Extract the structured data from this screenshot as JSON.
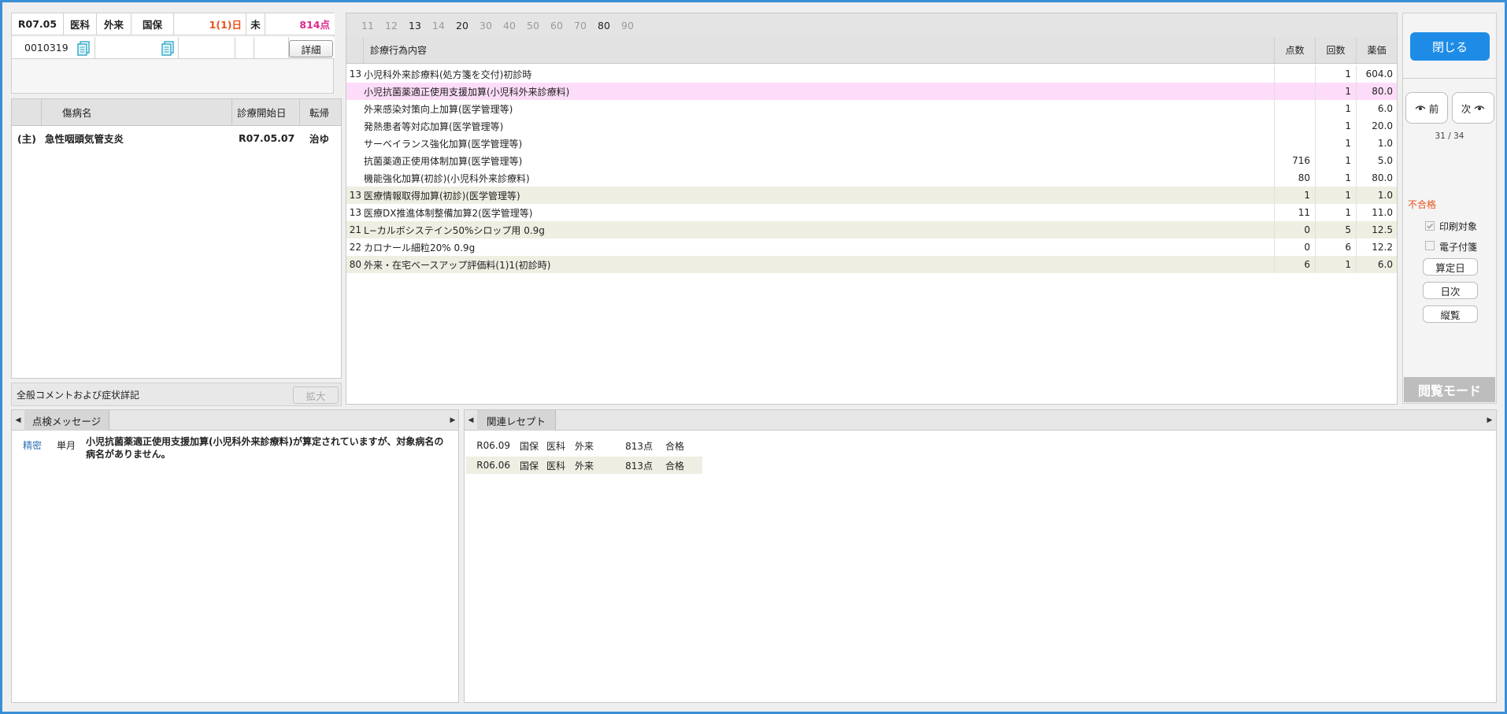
{
  "header": {
    "month": "R07.05",
    "dept": "医科",
    "visit_type": "外来",
    "insurance": "国保",
    "days": "1(1)日",
    "unsettled": "未",
    "points": "814点",
    "patient_id": "0010319",
    "detail_label": "詳細",
    "colors": {
      "days": "#e8521c",
      "points": "#e0288a"
    }
  },
  "diseases": {
    "headers": [
      "傷病名",
      "診療開始日",
      "転帰"
    ],
    "rows": [
      {
        "prefix": "(主)",
        "name": "急性咽頭気管支炎",
        "start": "R07.05.07",
        "outcome": "治ゆ"
      }
    ]
  },
  "comment": {
    "label": "全般コメントおよび症状詳記",
    "expand_label": "拡大"
  },
  "procedures": {
    "tab_numbers": [
      {
        "n": "11",
        "on": false
      },
      {
        "n": "12",
        "on": false
      },
      {
        "n": "13",
        "on": true
      },
      {
        "n": "14",
        "on": false
      },
      {
        "n": "20",
        "on": true
      },
      {
        "n": "30",
        "on": false
      },
      {
        "n": "40",
        "on": false
      },
      {
        "n": "50",
        "on": false
      },
      {
        "n": "60",
        "on": false
      },
      {
        "n": "70",
        "on": false
      },
      {
        "n": "80",
        "on": true
      },
      {
        "n": "90",
        "on": false
      }
    ],
    "headers": {
      "name": "診療行為内容",
      "points": "点数",
      "count": "回数",
      "price": "薬価"
    },
    "rows": [
      {
        "code": "13",
        "name": "小児科外来診療料(処方箋を交付)初診時",
        "points": "",
        "count": "1",
        "price": "604.0",
        "style": "plain"
      },
      {
        "code": "",
        "name": "小児抗菌薬適正使用支援加算(小児科外来診療料)",
        "points": "",
        "count": "1",
        "price": "80.0",
        "style": "pink"
      },
      {
        "code": "",
        "name": "外来感染対策向上加算(医学管理等)",
        "points": "",
        "count": "1",
        "price": "6.0",
        "style": "plain"
      },
      {
        "code": "",
        "name": "発熱患者等対応加算(医学管理等)",
        "points": "",
        "count": "1",
        "price": "20.0",
        "style": "plain"
      },
      {
        "code": "",
        "name": "サーベイランス強化加算(医学管理等)",
        "points": "",
        "count": "1",
        "price": "1.0",
        "style": "plain"
      },
      {
        "code": "",
        "name": "抗菌薬適正使用体制加算(医学管理等)",
        "points": "716",
        "count": "1",
        "price": "5.0",
        "style": "plain"
      },
      {
        "code": "",
        "name": "機能強化加算(初診)(小児科外来診療料)",
        "points": "80",
        "count": "1",
        "price": "80.0",
        "style": "plain"
      },
      {
        "code": "13",
        "name": "医療情報取得加算(初診)(医学管理等)",
        "points": "1",
        "count": "1",
        "price": "1.0",
        "style": "shade"
      },
      {
        "code": "13",
        "name": "医療DX推進体制整備加算2(医学管理等)",
        "points": "11",
        "count": "1",
        "price": "11.0",
        "style": "plain"
      },
      {
        "code": "21",
        "name": "L−カルボシステイン50%シロップ用 0.9g",
        "points": "0",
        "count": "5",
        "price": "12.5",
        "style": "shade"
      },
      {
        "code": "22",
        "name": "カロナール細粒20% 0.9g",
        "points": "0",
        "count": "6",
        "price": "12.2",
        "style": "plain"
      },
      {
        "code": "80",
        "name": "外来・在宅ベースアップ評価料(1)1(初診時)",
        "points": "6",
        "count": "1",
        "price": "6.0",
        "style": "shade"
      }
    ]
  },
  "side": {
    "close_label": "閉じる",
    "prev_label": "前",
    "next_label": "次",
    "pager": "31 / 34",
    "status": "不合格",
    "status_color": "#e8521c",
    "print_target": "印刷対象",
    "e_tag": "電子付箋",
    "calc_day_label": "算定日",
    "daily_label": "日次",
    "overview_label": "縦覧",
    "mode_label": "閲覧モード"
  },
  "check_messages": {
    "tab_label": "点検メッセージ",
    "rows": [
      {
        "kind": "精密",
        "period": "単月",
        "text_line1": "小児抗菌薬適正使用支援加算(小児科外来診療料)が算定されていますが、対象病名の",
        "text_line2": "病名がありません。"
      }
    ]
  },
  "related": {
    "tab_label": "関連レセプト",
    "rows": [
      {
        "month": "R06.09",
        "ins": "国保",
        "dept": "医科",
        "visit": "外来",
        "points": "813点",
        "result": "合格",
        "shade": false
      },
      {
        "month": "R06.06",
        "ins": "国保",
        "dept": "医科",
        "visit": "外来",
        "points": "813点",
        "result": "合格",
        "shade": true
      }
    ]
  }
}
